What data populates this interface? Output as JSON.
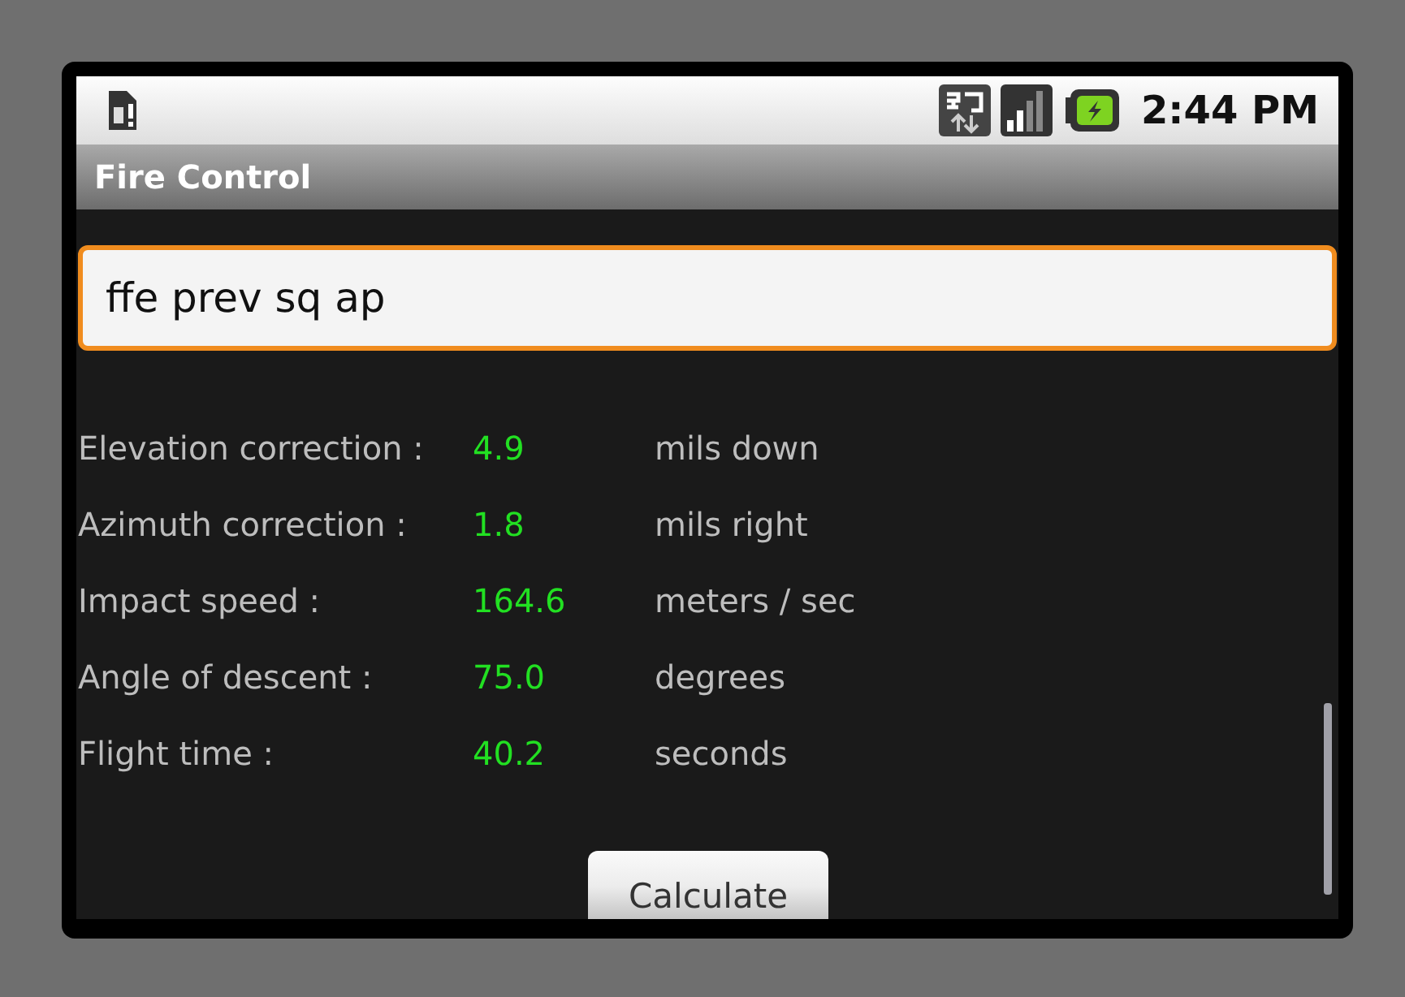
{
  "status_bar": {
    "time": "2:44 PM"
  },
  "title_bar": {
    "title": "Fire Control"
  },
  "command_field": {
    "value": "ffe prev sq ap"
  },
  "results": [
    {
      "label": "Elevation correction :",
      "value": "4.9",
      "unit": "mils down"
    },
    {
      "label": "Azimuth correction :",
      "value": "1.8",
      "unit": "mils right"
    },
    {
      "label": "Impact speed :",
      "value": "164.6",
      "unit": "meters / sec"
    },
    {
      "label": "Angle of descent :",
      "value": "75.0",
      "unit": "degrees"
    },
    {
      "label": "Flight time :",
      "value": "40.2",
      "unit": "seconds"
    }
  ],
  "calculate_button": {
    "label": "Calculate"
  }
}
